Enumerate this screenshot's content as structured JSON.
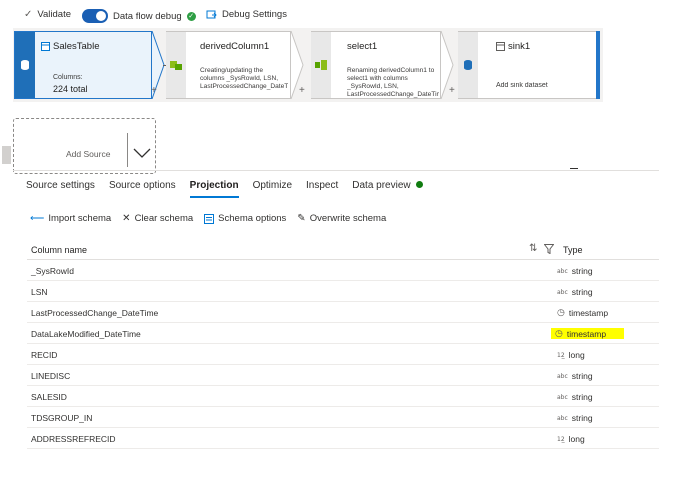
{
  "toolbar": {
    "validate_label": "Validate",
    "debug_label": "Data flow debug",
    "debug_settings_label": "Debug Settings"
  },
  "pipeline": {
    "source": {
      "title": "SalesTable",
      "columns_label": "Columns:",
      "columns_value": "224 total"
    },
    "derived": {
      "title": "derivedColumn1",
      "description": "Creating/updating the columns _SysRowId, LSN, LastProcessedChange_DateTime, DataLakeModified_DateTime"
    },
    "select": {
      "title": "select1",
      "description": "Renaming derivedColumn1 to select1 with columns _SysRowId, LSN, LastProcessedChange_DateTime"
    },
    "sink": {
      "title": "sink1",
      "description": "Add sink dataset"
    },
    "add_source_label": "Add Source",
    "plus": "+"
  },
  "tabs": [
    {
      "label": "Source settings"
    },
    {
      "label": "Source options"
    },
    {
      "label": "Projection"
    },
    {
      "label": "Optimize"
    },
    {
      "label": "Inspect"
    },
    {
      "label": "Data preview"
    }
  ],
  "active_tab": "Projection",
  "actions": {
    "import_schema": "Import schema",
    "clear_schema": "Clear schema",
    "schema_options": "Schema options",
    "overwrite_schema": "Overwrite schema"
  },
  "table": {
    "col_name_header": "Column name",
    "col_type_header": "Type",
    "rows": [
      {
        "name": "_SysRowId",
        "type": "string",
        "icon": "abc"
      },
      {
        "name": "LSN",
        "type": "string",
        "icon": "abc"
      },
      {
        "name": "LastProcessedChange_DateTime",
        "type": "timestamp",
        "icon": "clock"
      },
      {
        "name": "DataLakeModified_DateTime",
        "type": "timestamp",
        "icon": "clock"
      },
      {
        "name": "RECID",
        "type": "long",
        "icon": "123"
      },
      {
        "name": "LINEDISC",
        "type": "string",
        "icon": "abc"
      },
      {
        "name": "SALESID",
        "type": "string",
        "icon": "abc"
      },
      {
        "name": "TDSGROUP_IN",
        "type": "string",
        "icon": "abc"
      },
      {
        "name": "ADDRESSREFRECID",
        "type": "long",
        "icon": "123"
      }
    ]
  },
  "colors": {
    "accent": "#0078d4",
    "highlight": "#ffff00",
    "ok": "#107c10"
  }
}
